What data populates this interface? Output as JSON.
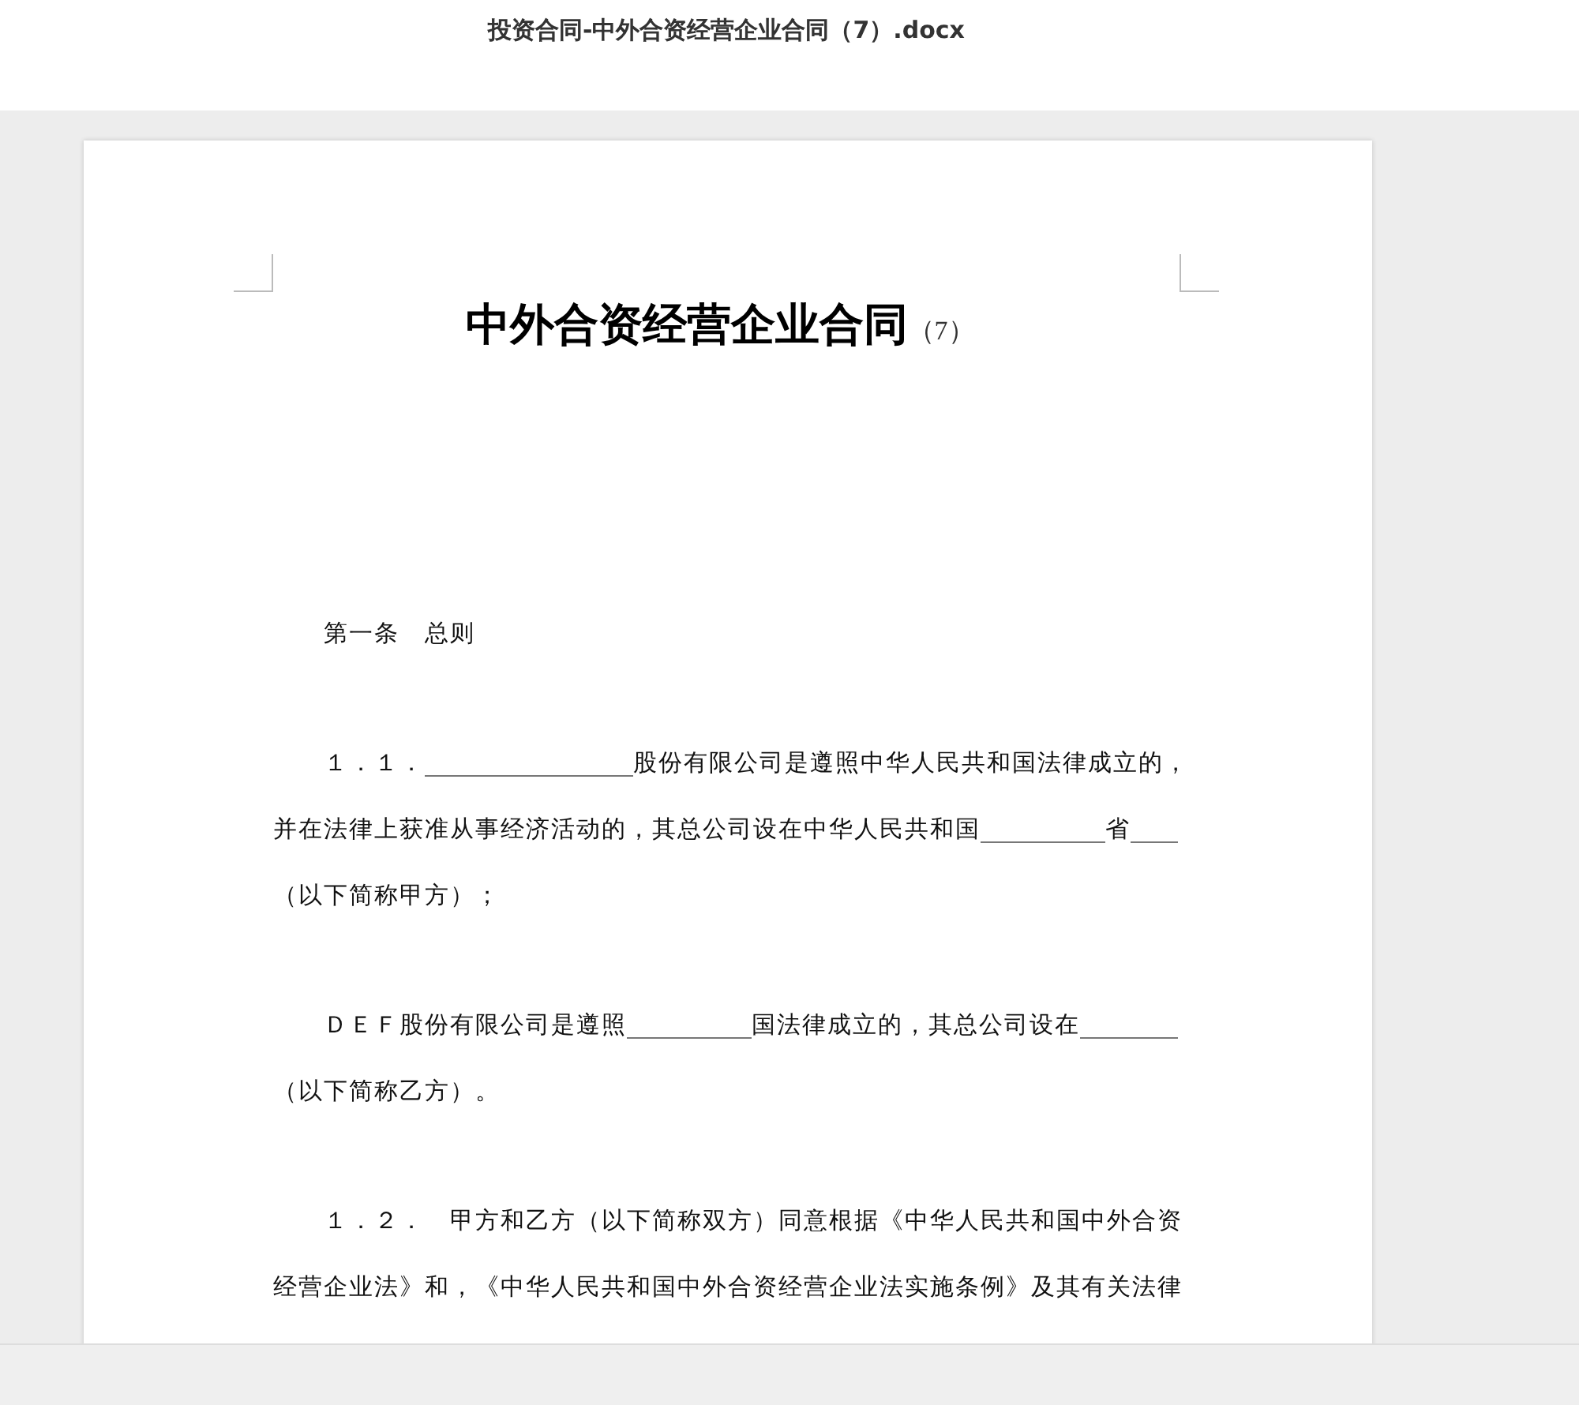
{
  "window": {
    "title": "投资合同-中外合资经营企业合同（7）.docx"
  },
  "document": {
    "title": "中外合资经营企业合同",
    "title_suffix": "（7）",
    "paragraphs": [
      {
        "lines": [
          [
            {
              "kind": "text",
              "text": "第一条　总则"
            }
          ]
        ]
      },
      {
        "lines": [
          [
            {
              "kind": "text",
              "text": "１．１．"
            },
            {
              "kind": "blank_long"
            },
            {
              "kind": "text",
              "text": "股份有限公司是遵照中华人民共和国法律成立的，"
            }
          ],
          [
            {
              "kind": "text",
              "text": "并在法律上获准从事经济活动的，其总公司设在中华人民共和国"
            },
            {
              "kind": "blank_medium"
            },
            {
              "kind": "text",
              "text": "省"
            },
            {
              "kind": "blank_short"
            }
          ],
          [
            {
              "kind": "text",
              "text": "（以下简称甲方）；"
            }
          ]
        ]
      },
      {
        "lines": [
          [
            {
              "kind": "text",
              "text": "ＤＥＦ股份有限公司是遵照"
            },
            {
              "kind": "blank_medium"
            },
            {
              "kind": "text",
              "text": "国法律成立的，其总公司设在"
            },
            {
              "kind": "blank_tail"
            }
          ],
          [
            {
              "kind": "text",
              "text": "（以下简称乙方）。"
            }
          ]
        ]
      },
      {
        "lines": [
          [
            {
              "kind": "text",
              "text": "１．２．　甲方和乙方（以下简称双方）同意根据《中华人民共和国中外合资"
            }
          ],
          [
            {
              "kind": "text",
              "text": "经营企业法》和，《中华人民共和国中外合资经营企业法实施条例》及其有关法律"
            }
          ]
        ]
      }
    ]
  }
}
